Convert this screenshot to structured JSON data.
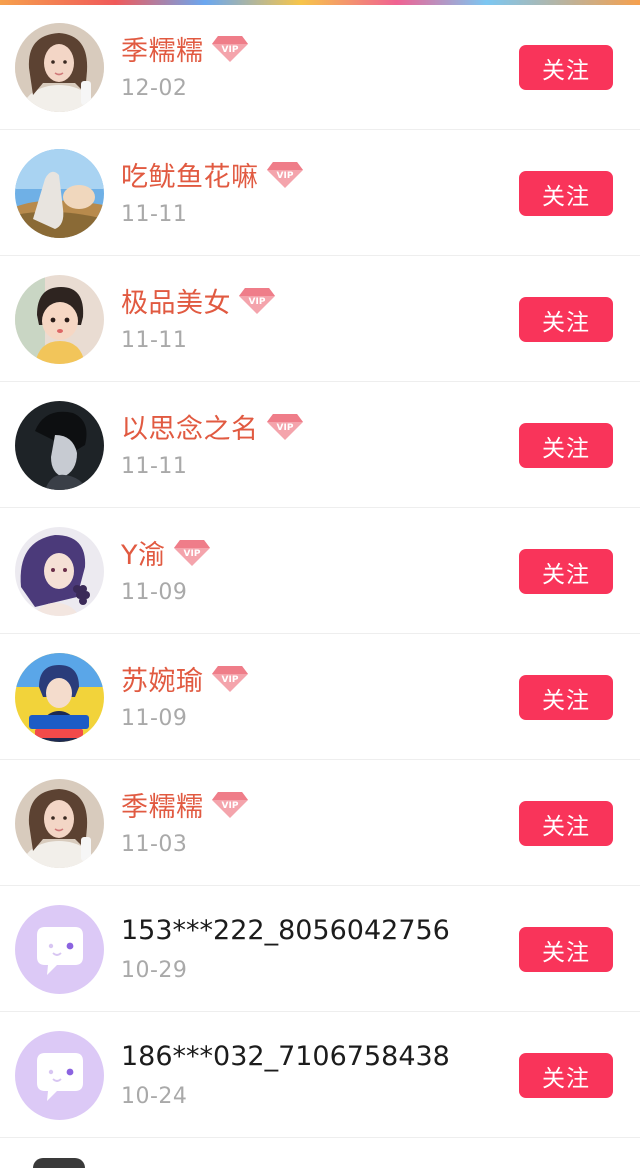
{
  "colors": {
    "name_accent": "#e15a41",
    "follow_button": "#f9345a",
    "date_gray": "#a9a9a9",
    "vip_badge": "#f07080"
  },
  "vip_label": "VIP",
  "users": [
    {
      "name": "季糯糯",
      "date": "12-02",
      "vip": true,
      "follow_label": "关注",
      "avatar": "photo-woman-light-hair"
    },
    {
      "name": "吃鱿鱼花嘛",
      "date": "11-11",
      "vip": true,
      "follow_label": "关注",
      "avatar": "photo-sky-landscape"
    },
    {
      "name": "极品美女",
      "date": "11-11",
      "vip": true,
      "follow_label": "关注",
      "avatar": "photo-child"
    },
    {
      "name": "以思念之名",
      "date": "11-11",
      "vip": true,
      "follow_label": "关注",
      "avatar": "photo-dark-portrait"
    },
    {
      "name": "Y渝",
      "date": "11-09",
      "vip": true,
      "follow_label": "关注",
      "avatar": "illustration-purple-hair"
    },
    {
      "name": "苏婉瑜",
      "date": "11-09",
      "vip": true,
      "follow_label": "关注",
      "avatar": "poster-yellow-blue"
    },
    {
      "name": "季糯糯",
      "date": "11-03",
      "vip": true,
      "follow_label": "关注",
      "avatar": "photo-woman-light-hair"
    },
    {
      "name": "153***222_8056042756",
      "date": "10-29",
      "vip": false,
      "follow_label": "关注",
      "avatar": "default-chat-bubble-icon"
    },
    {
      "name": "186***032_7106758438",
      "date": "10-24",
      "vip": false,
      "follow_label": "关注",
      "avatar": "default-chat-bubble-icon"
    }
  ]
}
